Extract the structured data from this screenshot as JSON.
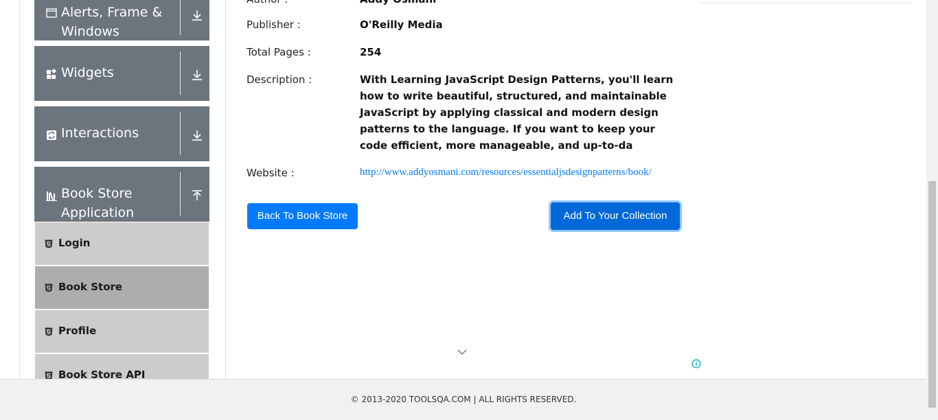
{
  "sidebar": {
    "groups": [
      {
        "label_line1": "Alerts, Frame &",
        "label_line2": "Windows",
        "icon": "window-icon",
        "arrow": "arrow-down-icon"
      },
      {
        "label": "Widgets",
        "icon": "widgets-icon",
        "arrow": "arrow-down-icon"
      },
      {
        "label": "Interactions",
        "icon": "interactions-icon",
        "arrow": "arrow-down-icon"
      },
      {
        "label_line1": "Book Store",
        "label_line2": "Application",
        "icon": "books-icon",
        "arrow": "arrow-up-icon"
      }
    ],
    "items": [
      {
        "label": "Login",
        "icon": "html5-icon",
        "active": false
      },
      {
        "label": "Book Store",
        "icon": "html5-icon",
        "active": true
      },
      {
        "label": "Profile",
        "icon": "html5-icon",
        "active": false
      },
      {
        "label": "Book Store API",
        "icon": "html5-icon",
        "active": false
      }
    ]
  },
  "book": {
    "author_label": "Author :",
    "author": "Addy Osmani",
    "publisher_label": "Publisher :",
    "publisher": "O'Reilly Media",
    "pages_label": "Total Pages :",
    "pages": "254",
    "description_label": "Description :",
    "description": "With Learning JavaScript Design Patterns, you'll learn how to write beautiful, structured, and maintainable JavaScript by applying classical and modern design patterns to the language. If you want to keep your code efficient, more manageable, and up-to-da",
    "website_label": "Website :",
    "website": "http://www.addyosmani.com/resources/essentialjsdesignpatterns/book/"
  },
  "buttons": {
    "back": "Back To Book Store",
    "add": "Add To Your Collection"
  },
  "footer": {
    "text": "© 2013-2020 TOOLSQA.COM | ALL RIGHTS RESERVED."
  },
  "colors": {
    "sidebar_group": "#6c757d",
    "sidebar_item": "#cccccc",
    "sidebar_item_active": "#adadad",
    "primary": "#007bff",
    "link": "#007bff"
  }
}
